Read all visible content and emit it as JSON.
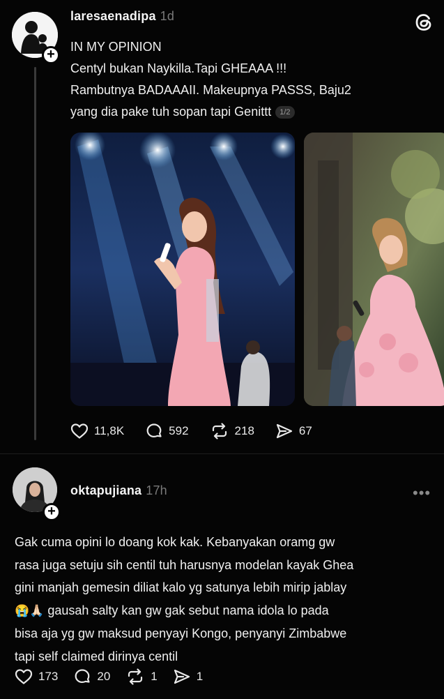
{
  "post": {
    "username": "laresaenadipa",
    "time": "1d",
    "lines": [
      "IN MY OPINION",
      "Centyl bukan Naykilla.Tapi GHEAAA !!!",
      "Rambutnya BADAAAII. Makeupnya PASSS, Baju2",
      "yang dia pake tuh sopan tapi Genittt"
    ],
    "page_indicator": "1/2",
    "likes": "11,8K",
    "comments": "592",
    "reposts": "218",
    "shares": "67"
  },
  "reply": {
    "username": "oktapujiana",
    "time": "17h",
    "lines": [
      "Gak cuma opini lo doang kok kak. Kebanyakan oramg gw",
      "rasa juga setuju sih centil tuh harusnya modelan kayak Ghea",
      "gini manjah gemesin diliat kalo yg satunya lebih mirip jablay",
      "gausah salty kan gw gak sebut nama idola lo pada",
      "bisa aja yg gw maksud penyayi Kongo, penyanyi Zimbabwe",
      "tapi self claimed dirinya centil"
    ],
    "emoji": "😭🙏🏻",
    "likes": "173",
    "comments": "20",
    "reposts": "1",
    "shares": "1"
  },
  "icons": {
    "logo": "threads-logo-icon",
    "like": "heart-icon",
    "comment": "comment-bubble-icon",
    "repost": "repost-icon",
    "share": "send-icon",
    "follow": "plus-icon",
    "more": "more-dots-icon"
  },
  "colors": {
    "background": "#050505",
    "text": "#f0f0f0",
    "muted": "#7a7a7a",
    "stage_pink": "#f3a7b3",
    "stage_blue": "#5aa6e6"
  }
}
